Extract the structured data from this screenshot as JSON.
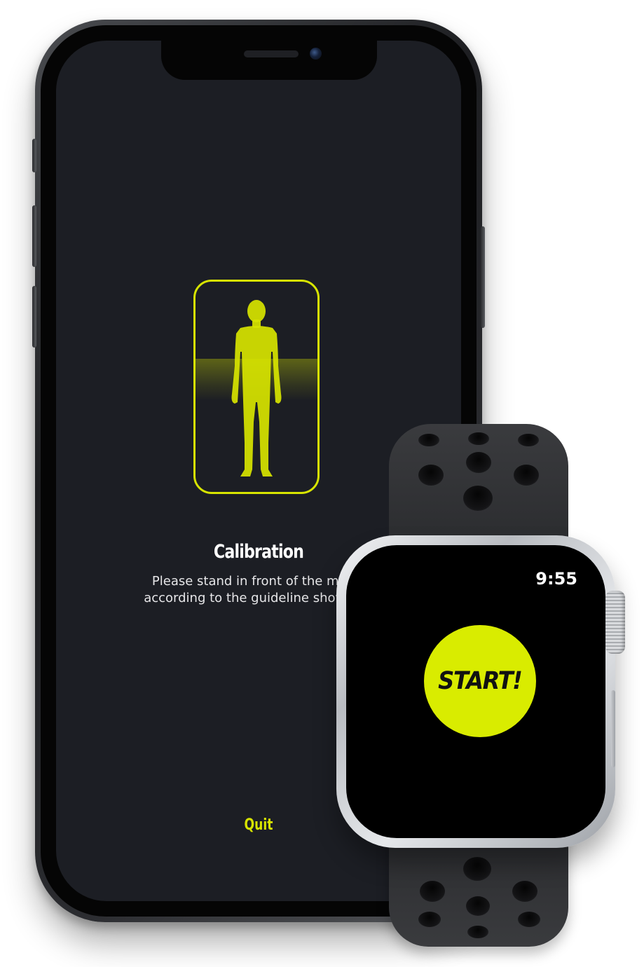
{
  "phone": {
    "calibration": {
      "title": "Calibration",
      "description_line1": "Please stand in front of the mirror",
      "description_line2": "according to the guideline shown on"
    },
    "quit_label": "Quit"
  },
  "watch": {
    "time": "9:55",
    "start_label": "START!"
  },
  "colors": {
    "accent": "#d7e400",
    "phone_screen_bg": "#1c1e24",
    "watch_screen_bg": "#000000"
  },
  "icons": {
    "figure": "human-silhouette-icon"
  }
}
